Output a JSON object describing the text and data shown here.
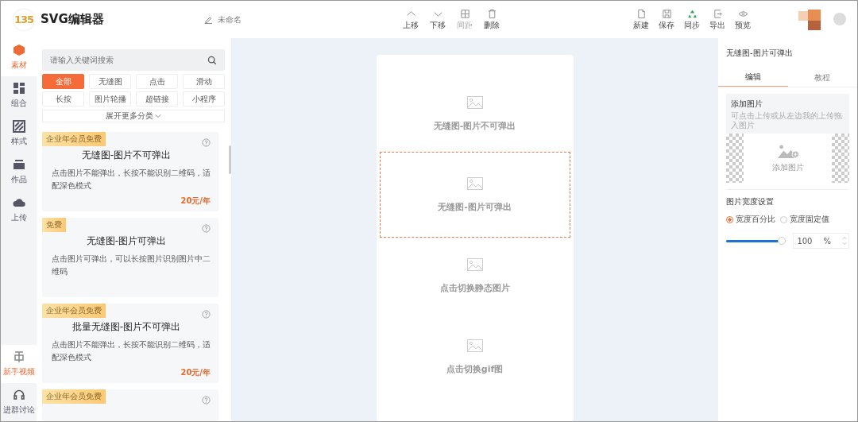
{
  "header": {
    "logo": "135",
    "app_title": "SVG编辑器",
    "doc_name": "未命名",
    "edit_tools": [
      {
        "label": "上移",
        "disabled": false
      },
      {
        "label": "下移",
        "disabled": false
      },
      {
        "label": "间距",
        "disabled": true
      },
      {
        "label": "删除",
        "disabled": false
      }
    ],
    "file_tools": [
      {
        "label": "新建"
      },
      {
        "label": "保存"
      },
      {
        "label": "同步"
      },
      {
        "label": "导出"
      },
      {
        "label": "预览"
      }
    ]
  },
  "rail": {
    "items": [
      {
        "label": "素材",
        "selected": true
      },
      {
        "label": "组合",
        "selected": false
      },
      {
        "label": "样式",
        "selected": false
      },
      {
        "label": "作品",
        "selected": false
      },
      {
        "label": "上传",
        "selected": false
      }
    ],
    "bottom": [
      {
        "label": "新手视频",
        "highlighted": true
      },
      {
        "label": "进群讨论",
        "highlighted": false
      }
    ]
  },
  "library": {
    "search": {
      "placeholder": "请输入关键词搜索"
    },
    "filters": [
      {
        "label": "全部",
        "selected": true
      },
      {
        "label": "无缝图",
        "selected": false
      },
      {
        "label": "点击",
        "selected": false
      },
      {
        "label": "滑动",
        "selected": false
      },
      {
        "label": "长按",
        "selected": false
      },
      {
        "label": "图片轮播",
        "selected": false
      },
      {
        "label": "超链接",
        "selected": false
      },
      {
        "label": "小程序",
        "selected": false
      }
    ],
    "expand": "展开更多分类",
    "cards": [
      {
        "badge": "企业年会员免费",
        "title": "无缝图-图片不可弹出",
        "description": "点击图片不能弹出，长按不能识别二维码，适配深色模式",
        "price": "20元/年"
      },
      {
        "badge": "免费",
        "title": "无缝图-图片可弹出",
        "description": "点击图片可弹出，可以长按图片识别图片中二维码"
      },
      {
        "badge": "企业年会员免费",
        "title": "批量无缝图-图片不可弹出",
        "description": "点击图片不能弹出，长按不能识别二维码，适配深色模式",
        "price": "20元/年"
      },
      {
        "badge": "企业年会员免费"
      }
    ]
  },
  "canvas": {
    "blocks": [
      {
        "label": "无缝图-图片不可弹出",
        "selected": false
      },
      {
        "label": "无缝图-图片可弹出",
        "selected": true
      },
      {
        "label": "点击切换静态图片",
        "selected": false
      },
      {
        "label": "点击切换gif图",
        "selected": false
      }
    ]
  },
  "inspector": {
    "title": "无缝图-图片可弹出",
    "tabs": [
      {
        "label": "编辑",
        "selected": true
      },
      {
        "label": "教程",
        "selected": false
      }
    ],
    "add_image": {
      "heading": "添加图片",
      "hint": "可点击上传或从左边我的上传拖入图片",
      "drop_label": "添加图片"
    },
    "width_setting": {
      "heading": "图片宽度设置",
      "options": [
        {
          "label": "宽度百分比",
          "selected": true
        },
        {
          "label": "宽度固定值",
          "selected": false
        }
      ],
      "slider": {
        "level": 1
      },
      "value": "100",
      "unit": "%"
    }
  }
}
